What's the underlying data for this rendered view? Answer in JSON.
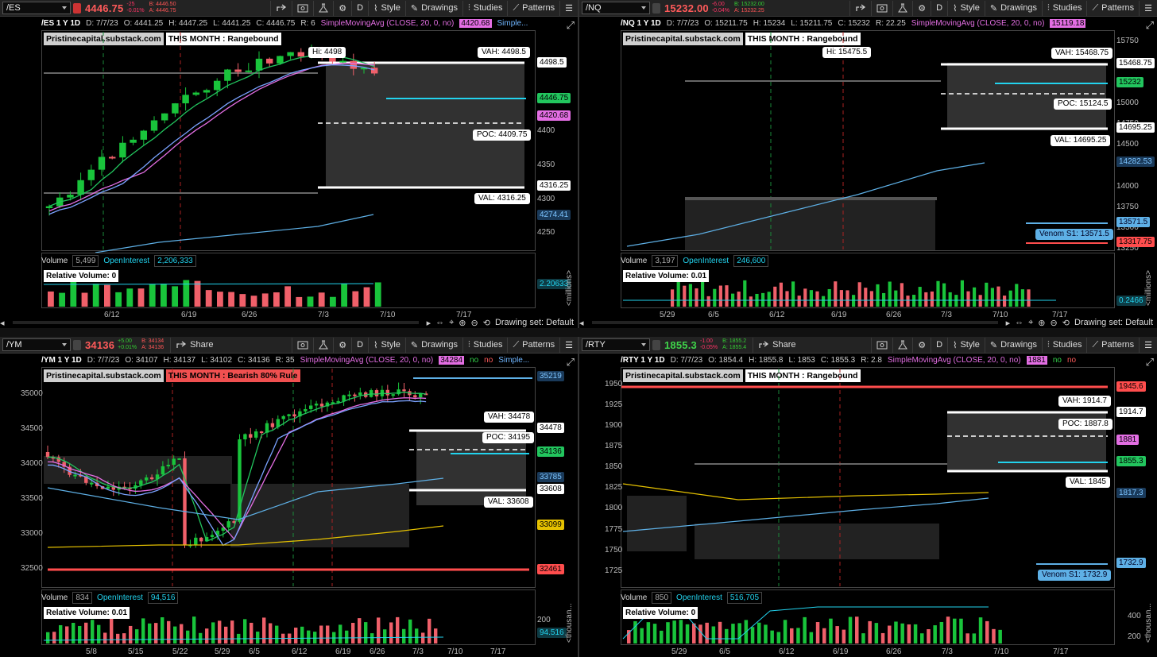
{
  "toolbar_labels": {
    "style": "Style",
    "drawings": "Drawings",
    "studies": "Studies",
    "patterns": "Patterns",
    "share": "Share",
    "period": "D"
  },
  "footer": {
    "drawing_set": "Drawing set: Default"
  },
  "colors": {
    "up": "#19c43b",
    "down": "#f0606a",
    "sma": "#e36ee3",
    "ema": "#22c55e",
    "long_ma": "#5eb0e6",
    "vp": "#ffffff",
    "cyan": "#22d3ee",
    "red_line": "#ff4d4d"
  },
  "panels": [
    {
      "symbol": "/ES",
      "price": "4446.75",
      "change": "-25",
      "change_pct": "-0.01%",
      "bid": "B: 4446.50",
      "ask": "A: 4446.75",
      "header": {
        "title": "/ES 1 Y 1D",
        "date": "D: 7/7/23",
        "open": "O: 4441.25",
        "high": "H: 4447.25",
        "low": "L: 4441.25",
        "close": "C: 4446.75",
        "range": "R: 6",
        "study": "SimpleMovingAvg (CLOSE, 20, 0, no)",
        "study_value": "4420.68",
        "study2": "Simple..."
      },
      "tag1": "Pristinecapital.substack.com",
      "tag2": "THIS MONTH : Rangebound",
      "tag2_style": "white",
      "labels": [
        {
          "text": "Hi: 4498"
        },
        {
          "text": "VAH: 4498.5"
        },
        {
          "text": "POC: 4409.75"
        },
        {
          "text": "VAL: 4316.25"
        }
      ],
      "price_axis": [
        "4500",
        "4450",
        "4400",
        "4350",
        "4300",
        "4250"
      ],
      "badges": [
        "4498.5",
        "4446.75",
        "4420.68",
        "4316.25",
        "4274.41"
      ],
      "x_axis": [
        "6/12",
        "6/19",
        "6/26",
        "7/3",
        "7/10",
        "7/17"
      ],
      "volume": {
        "label": "Volume",
        "value": "5,499",
        "oi_label": "OpenInterest",
        "oi_value": "2,206,333",
        "relative": "Relative Volume: 0",
        "axis_badge": "2.20633",
        "unit": "<millions>"
      }
    },
    {
      "symbol": "/NQ",
      "price": "15232.00",
      "change": "-6.00",
      "change_pct": "-0.04%",
      "bid": "B: 15232.00",
      "ask": "A: 15232.25",
      "header": {
        "title": "/NQ 1 Y 1D",
        "date": "D: 7/7/23",
        "open": "O: 15211.75",
        "high": "H: 15234",
        "low": "L: 15211.75",
        "close": "C: 15232",
        "range": "R: 22.25",
        "study": "SimpleMovingAvg (CLOSE, 20, 0, no)",
        "study_value": "15119.18",
        "study2": ""
      },
      "tag1": "Pristinecapital.substack.com",
      "tag2": "THIS MONTH : Rangebound",
      "tag2_style": "white",
      "labels": [
        {
          "text": "Hi: 15475.5"
        },
        {
          "text": "VAH: 15468.75"
        },
        {
          "text": "POC: 15124.5"
        },
        {
          "text": "VAL: 14695.25"
        },
        {
          "text": "Venom S1: 13571.5"
        }
      ],
      "price_axis": [
        "15750",
        "15500",
        "15250",
        "15000",
        "14750",
        "14500",
        "14250",
        "14000",
        "13750",
        "13500",
        "13250"
      ],
      "badges": [
        "15468.75",
        "15232",
        "14695.25",
        "14282.53",
        "13571.5",
        "13317.75"
      ],
      "x_axis": [
        "5/29",
        "6/5",
        "6/12",
        "6/19",
        "6/26",
        "7/3",
        "7/10",
        "7/17"
      ],
      "volume": {
        "label": "Volume",
        "value": "3,197",
        "oi_label": "OpenInterest",
        "oi_value": "246,600",
        "relative": "Relative Volume: 0.01",
        "axis_badge": "0.2466",
        "unit": "<millions>"
      }
    },
    {
      "symbol": "/YM",
      "price": "34136",
      "change": "+5.00",
      "change_pct": "+0.01%",
      "bid": "B: 34134",
      "ask": "A: 34136",
      "header": {
        "title": "/YM 1 Y 1D",
        "date": "D: 7/7/23",
        "open": "O: 34107",
        "high": "H: 34137",
        "low": "L: 34102",
        "close": "C: 34136",
        "range": "R: 35",
        "study": "SimpleMovingAvg (CLOSE, 20, 0, no)",
        "study_value": "34284",
        "study2": "no",
        "study3": "no",
        "study4": "Simple..."
      },
      "tag1": "Pristinecapital.substack.com",
      "tag2": "THIS MONTH : Bearish 80% Rule",
      "tag2_style": "red",
      "labels": [
        {
          "text": "VAH: 34478"
        },
        {
          "text": "POC: 34195"
        },
        {
          "text": "VAL: 33608"
        }
      ],
      "price_axis": [
        "35000",
        "34500",
        "34000",
        "33500",
        "33000",
        "32500"
      ],
      "badges": [
        "35219",
        "34478",
        "34136",
        "33785",
        "33608",
        "33099",
        "32461"
      ],
      "x_axis": [
        "5/8",
        "5/15",
        "5/22",
        "5/29",
        "6/5",
        "6/12",
        "6/19",
        "6/26",
        "7/3",
        "7/10",
        "7/17"
      ],
      "volume": {
        "label": "Volume",
        "value": "834",
        "oi_label": "OpenInterest",
        "oi_value": "94,516",
        "relative": "Relative Volume: 0.01",
        "axis_badge": "94.516",
        "axis_tick": "200",
        "unit": "<thousan..."
      }
    },
    {
      "symbol": "/RTY",
      "price": "1855.3",
      "change": "-1.00",
      "change_pct": "-0.05%",
      "bid": "B: 1855.2",
      "ask": "A: 1855.4",
      "header": {
        "title": "/RTY 1 Y 1D",
        "date": "D: 7/7/23",
        "open": "O: 1854.4",
        "high": "H: 1855.8",
        "low": "L: 1853",
        "close": "C: 1855.3",
        "range": "R: 2.8",
        "study": "SimpleMovingAvg (CLOSE, 20, 0, no)",
        "study_value": "1881",
        "study2": "no",
        "study3": "no"
      },
      "tag1": "Pristinecapital.substack.com",
      "tag2": "THIS MONTH : Rangebound",
      "tag2_style": "white",
      "labels": [
        {
          "text": "VAH: 1914.7"
        },
        {
          "text": "POC: 1887.8"
        },
        {
          "text": "VAL: 1845"
        },
        {
          "text": "Venom S1: 1732.9"
        }
      ],
      "price_axis": [
        "1950",
        "1925",
        "1900",
        "1875",
        "1850",
        "1825",
        "1800",
        "1775",
        "1750",
        "1725"
      ],
      "badges": [
        "1945.6",
        "1914.7",
        "1881",
        "1855.3",
        "1817.3",
        "1732.9"
      ],
      "x_axis": [
        "5/29",
        "6/5",
        "6/12",
        "6/19",
        "6/26",
        "7/3",
        "7/10",
        "7/17"
      ],
      "volume": {
        "label": "Volume",
        "value": "850",
        "oi_label": "OpenInterest",
        "oi_value": "516,705",
        "relative": "Relative Volume: 0",
        "axis_tick": "400",
        "axis_tick2": "200",
        "unit": "<thousan..."
      }
    }
  ]
}
